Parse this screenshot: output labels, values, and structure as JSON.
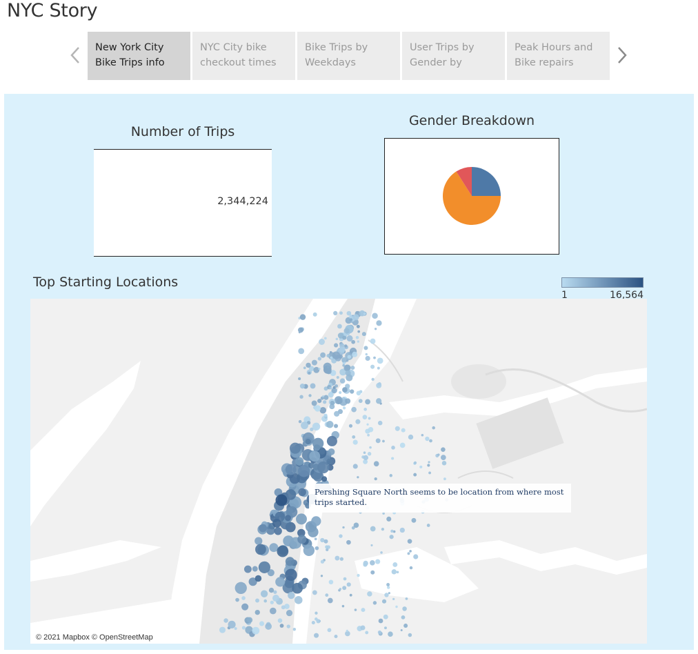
{
  "story": {
    "title": "NYC Story"
  },
  "nav": {
    "tabs": [
      {
        "label": "New York City Bike Trips info",
        "active": true
      },
      {
        "label": "NYC City bike checkout times",
        "active": false
      },
      {
        "label": "Bike Trips by Weekdays",
        "active": false
      },
      {
        "label": "User Trips by Gender by",
        "active": false
      },
      {
        "label": "Peak Hours and Bike repairs",
        "active": false
      }
    ],
    "prev_icon": "chevron-left-icon",
    "next_icon": "chevron-right-icon"
  },
  "kpi": {
    "title": "Number of Trips",
    "value": "2,344,224"
  },
  "gender": {
    "title": "Gender Breakdown",
    "chart_data": {
      "type": "pie",
      "slices": [
        {
          "value": 25,
          "color": "#4e79a7"
        },
        {
          "value": 66,
          "color": "#f28e2b"
        },
        {
          "value": 9,
          "color": "#e15759"
        }
      ]
    }
  },
  "map": {
    "title": "Top Starting Locations",
    "legend": {
      "min": "1",
      "max": "16,564",
      "color_low": "#b9dbf0",
      "color_high": "#2b5282"
    },
    "annotation": "Pershing Square North seems to be location from where most trips started.",
    "credit": "© 2021 Mapbox © OpenStreetMap"
  }
}
